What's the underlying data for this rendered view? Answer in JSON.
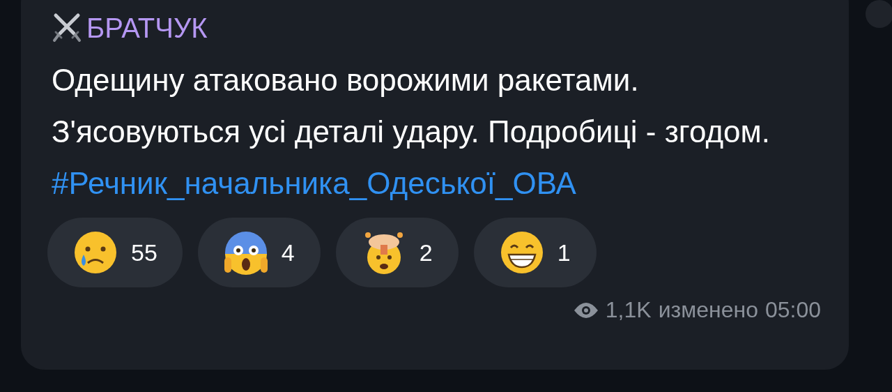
{
  "message": {
    "author": "БРАТЧУК",
    "text": "Одещину атаковано ворожими ракетами. З'ясовуються усі деталі удару. Подробиці - згодом.",
    "hashtag": "#Речник_начальника_Одеської_ОВА",
    "reactions": [
      {
        "kind": "crying",
        "count": "55"
      },
      {
        "kind": "screaming",
        "count": "4"
      },
      {
        "kind": "exploding",
        "count": "2"
      },
      {
        "kind": "grinning",
        "count": "1"
      }
    ],
    "views": "1,1K",
    "edited": "изменено",
    "time": "05:00"
  }
}
